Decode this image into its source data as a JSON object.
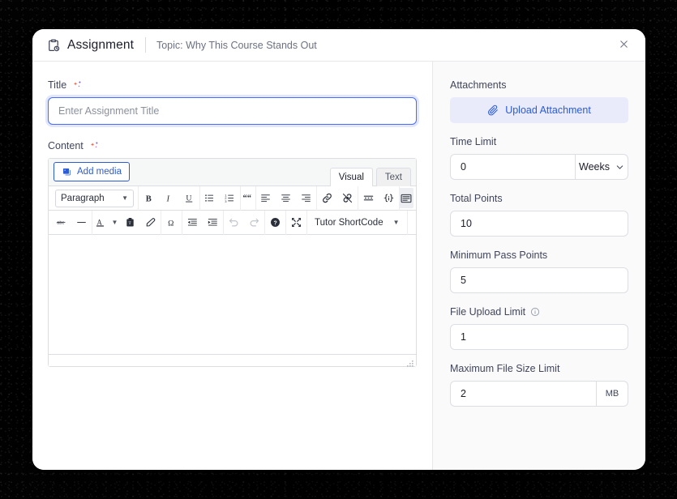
{
  "header": {
    "icon": "clipboard-clock-icon",
    "title": "Assignment",
    "topic": "Topic: Why This Course Stands Out",
    "close_icon": "close-icon"
  },
  "left": {
    "title_field": {
      "label": "Title",
      "ai_icon": "sparkle-ai-icon",
      "value": "",
      "placeholder": "Enter Assignment Title"
    },
    "content_field": {
      "label": "Content",
      "ai_icon": "sparkle-ai-icon"
    },
    "editor": {
      "add_media_label": "Add media",
      "add_media_icon": "media-icon",
      "tabs": [
        {
          "label": "Visual",
          "active": true
        },
        {
          "label": "Text",
          "active": false
        }
      ],
      "format_select": "Paragraph",
      "toolbar_row1": [
        "bold-icon",
        "italic-icon",
        "underline-icon",
        "bulleted-list-icon",
        "numbered-list-icon",
        "blockquote-icon",
        "align-left-icon",
        "align-center-icon",
        "align-right-icon",
        "link-icon",
        "unlink-icon",
        "insert-read-more-icon",
        "shortcode-icon",
        "toggle-toolbar-icon"
      ],
      "toolbar_row2": [
        "strikethrough-icon",
        "horizontal-rule-icon",
        "text-color-icon",
        "paste-as-text-icon",
        "clear-formatting-icon",
        "special-character-icon",
        "outdent-icon",
        "indent-icon",
        "undo-icon",
        "redo-icon",
        "help-icon",
        "fullscreen-icon"
      ],
      "shortcode_button": "Tutor ShortCode",
      "body_text": "",
      "resize_handle": "resize-handle"
    }
  },
  "right": {
    "attachments": {
      "label": "Attachments",
      "upload_label": "Upload Attachment",
      "upload_icon": "paperclip-icon"
    },
    "time_limit": {
      "label": "Time Limit",
      "value": "0",
      "unit": "Weeks",
      "unit_icon": "chevron-down-icon"
    },
    "total_points": {
      "label": "Total Points",
      "value": "10"
    },
    "minimum_pass_points": {
      "label": "Minimum Pass Points",
      "value": "5"
    },
    "file_upload_limit": {
      "label": "File Upload Limit",
      "info_icon": "info-circle-icon",
      "value": "1"
    },
    "maximum_file_size_limit": {
      "label": "Maximum File Size Limit",
      "value": "2",
      "unit": "MB"
    }
  },
  "colors": {
    "accent_blue": "#2b5bd7",
    "focus_blue": "#4a6cf7",
    "upload_bg": "#e9ebfa",
    "panel_bg": "#fafafa",
    "border": "#dcdee4",
    "text_dark": "#1c1d2a",
    "text_muted": "#6d7180"
  }
}
